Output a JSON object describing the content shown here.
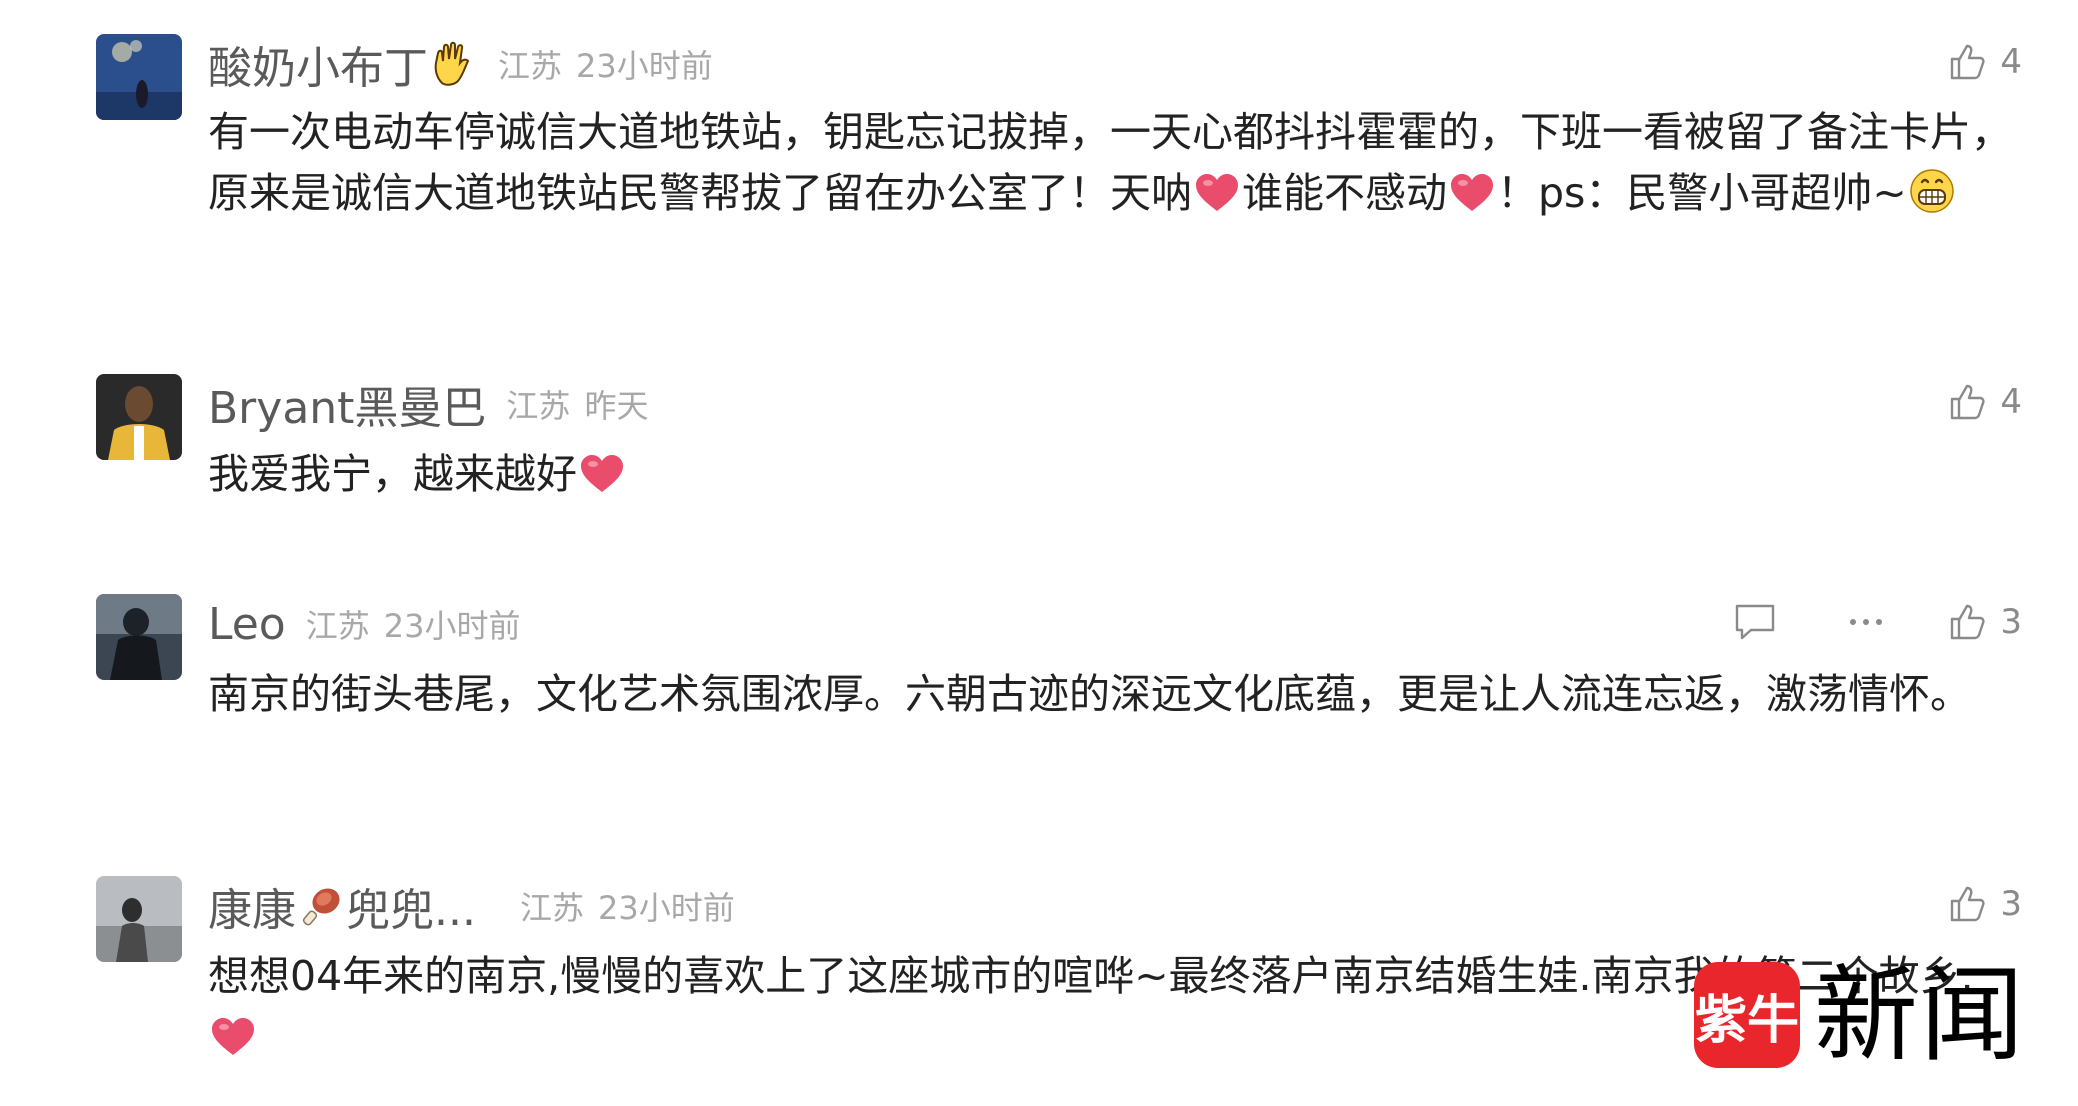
{
  "comments": [
    {
      "username": "酸奶小布丁",
      "location": "江苏",
      "time": "23小时前",
      "likes": "4",
      "body": {
        "p1": "有一次电动车停诚信大道地铁站，钥匙忘记拔掉，一天心都抖抖霍霍的，下班一看被留了备注卡片，原来是诚信大道地铁站民警帮拔了留在办公室了！天呐",
        "p2": "谁能不感动",
        "p3": "！ps：民警小哥超帅~"
      }
    },
    {
      "username": "Bryant黑曼巴",
      "location": "江苏",
      "time": "昨天",
      "likes": "4",
      "body": {
        "p1": "我爱我宁，越来越好"
      }
    },
    {
      "username": "Leo",
      "location": "江苏",
      "time": "23小时前",
      "likes": "3",
      "body": {
        "p1": "南京的街头巷尾，文化艺术氛围浓厚。六朝古迹的深远文化底蕴，更是让人流连忘返，激荡情怀。"
      }
    },
    {
      "username_a": "康康",
      "username_b": "兜兜...",
      "location": "江苏",
      "time": "23小时前",
      "likes": "3",
      "body": {
        "p1": "想想04年来的南京,慢慢的喜欢上了这座城市的喧哗~最终落户南京结婚生娃.南京我的第二个故乡."
      }
    }
  ],
  "watermark": {
    "logo_text": "紫牛",
    "text": "新闻",
    "color": "#e8262b"
  },
  "icons": {
    "like": "thumbs-up-icon",
    "reply": "comment-bubble-icon",
    "more": "more-dots-icon",
    "heart": "heart-emoji-icon",
    "grin": "grin-emoji-icon",
    "hand": "raised-hand-emoji-icon",
    "drumstick": "meat-emoji-icon"
  },
  "colors": {
    "username": "#5a5a5a",
    "meta": "#a8a8a8",
    "heart": "#ea4c6b"
  }
}
